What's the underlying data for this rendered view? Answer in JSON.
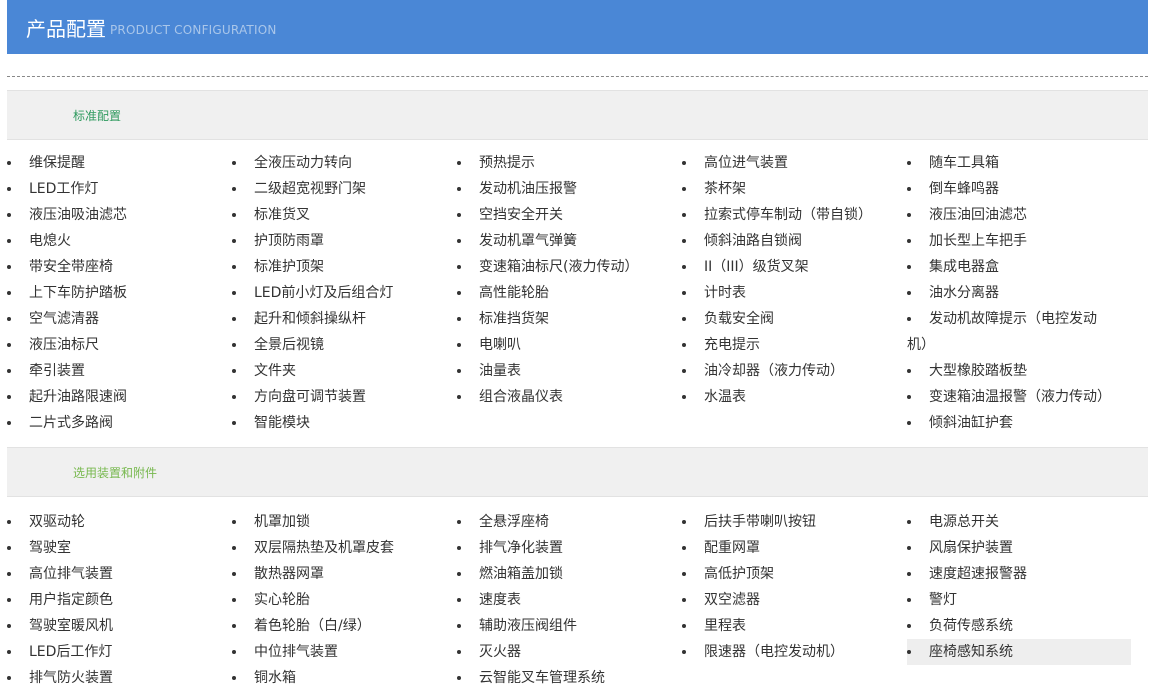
{
  "header": {
    "title_cn": "产品配置",
    "title_en": "PRODUCT CONFIGURATION"
  },
  "sections": {
    "standard": {
      "label": "标准配置",
      "columns": [
        [
          "维保提醒",
          "LED工作灯",
          "液压油吸油滤芯",
          "电熄火",
          "带安全带座椅",
          "上下车防护踏板",
          "空气滤清器",
          "液压油标尺",
          "牵引装置",
          "起升油路限速阀",
          "二片式多路阀"
        ],
        [
          "全液压动力转向",
          "二级超宽视野门架",
          "标准货叉",
          "护顶防雨罩",
          "标准护顶架",
          "LED前小灯及后组合灯",
          "起升和倾斜操纵杆",
          "全景后视镜",
          "文件夹",
          "方向盘可调节装置",
          "智能模块"
        ],
        [
          "预热提示",
          "发动机油压报警",
          "空挡安全开关",
          "发动机罩气弹簧",
          "变速箱油标尺(液力传动）",
          "高性能轮胎",
          "标准挡货架",
          "电喇叭",
          "油量表",
          "组合液晶仪表"
        ],
        [
          "高位进气装置",
          "茶杯架",
          "拉索式停车制动（带自锁）",
          "倾斜油路自锁阀",
          "II（III）级货叉架",
          "计时表",
          "负载安全阀",
          "充电提示",
          "油冷却器（液力传动）",
          "水温表"
        ],
        [
          "随车工具箱",
          "倒车蜂鸣器",
          "液压油回油滤芯",
          "加长型上车把手",
          "集成电器盒",
          "油水分离器",
          "发动机故障提示（电控发动",
          "机）",
          "大型橡胶踏板垫",
          "变速箱油温报警（液力传动）",
          "倾斜油缸护套"
        ]
      ]
    },
    "optional": {
      "label": "选用装置和附件",
      "columns": [
        [
          "双驱动轮",
          "驾驶室",
          "高位排气装置",
          "用户指定颜色",
          "驾驶室暖风机",
          "LED后工作灯",
          "排气防火装置"
        ],
        [
          "机罩加锁",
          "双层隔热垫及机罩皮套",
          "散热器网罩",
          "实心轮胎",
          "着色轮胎（白/绿）",
          "中位排气装置",
          "铜水箱"
        ],
        [
          "全悬浮座椅",
          "排气净化装置",
          "燃油箱盖加锁",
          "速度表",
          "辅助液压阀组件",
          "灭火器",
          "云智能叉车管理系统"
        ],
        [
          "后扶手带喇叭按钮",
          "配重网罩",
          "高低护顶架",
          "双空滤器",
          "里程表",
          "限速器（电控发动机）"
        ],
        [
          "电源总开关",
          "风扇保护装置",
          "速度超速报警器",
          "警灯",
          "负荷传感系统",
          "座椅感知系统"
        ]
      ]
    }
  },
  "colors": {
    "header_bg": "#4a87d6",
    "section_bg": "#f0f0f0",
    "standard_label": "#2f9a5f",
    "optional_label": "#77b84e"
  }
}
